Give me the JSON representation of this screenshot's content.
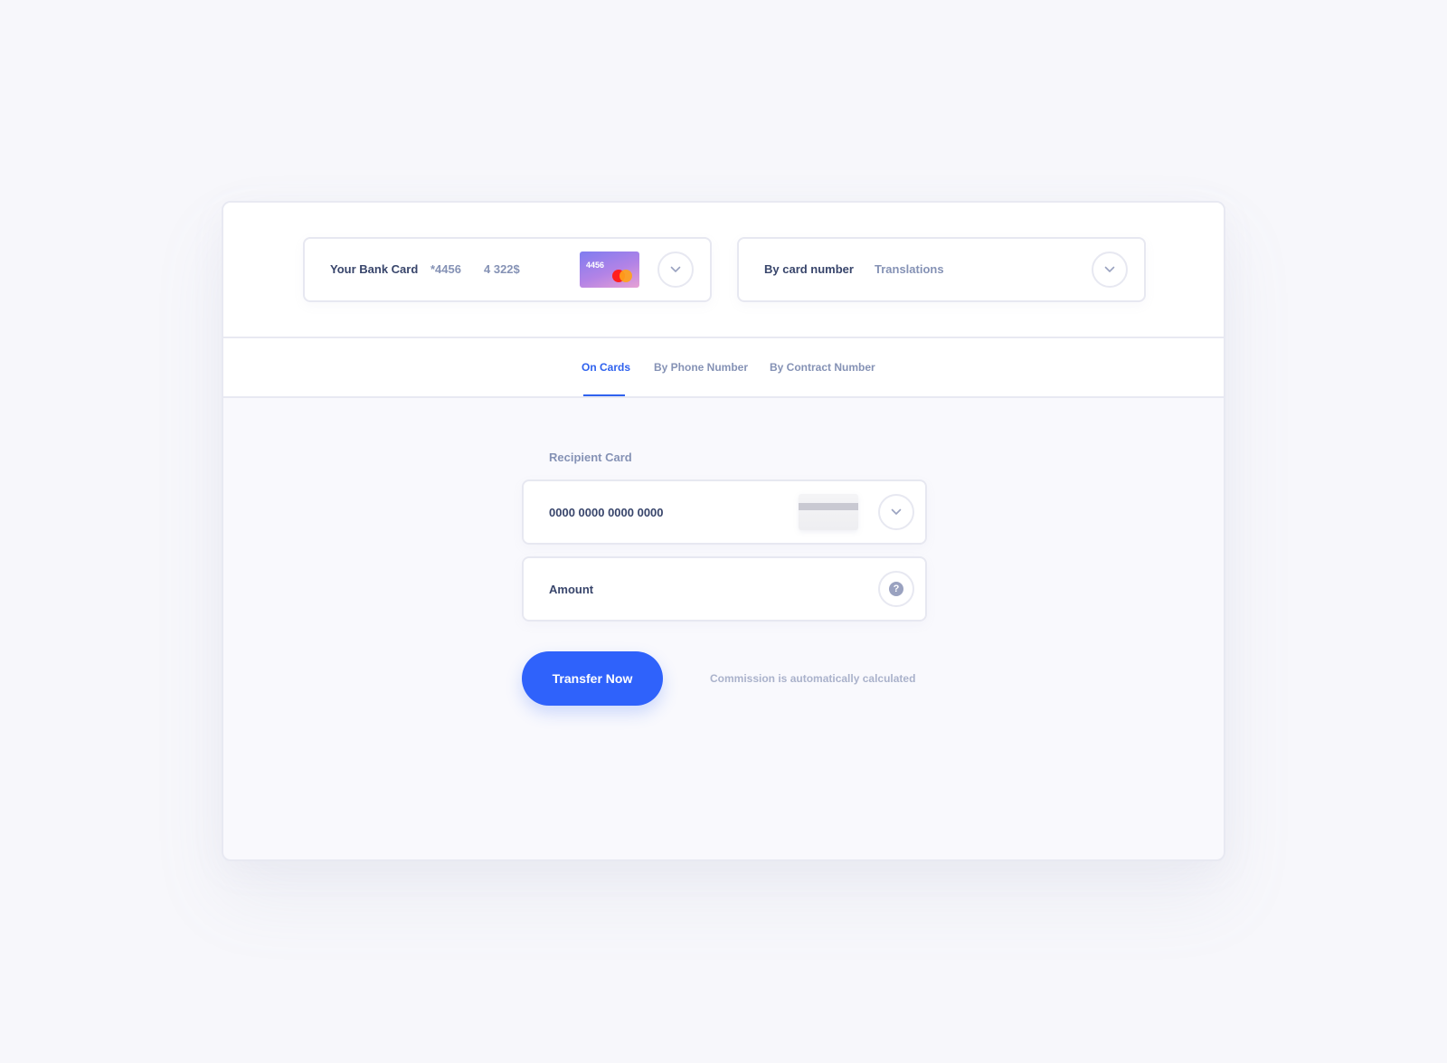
{
  "colors": {
    "accent": "#2f62fb",
    "text_dark": "#38456b",
    "text_muted": "#8592b5",
    "border": "#e7e8f1",
    "background": "#f7f7fb"
  },
  "source_card": {
    "label": "Your Bank Card",
    "masked_number": "*4456",
    "balance": "4 322$",
    "card_thumbnail_number": "4456",
    "card_brand_icon": "mastercard-logo-icon",
    "dropdown_icon": "chevron-down-icon"
  },
  "method_select": {
    "label": "By card number",
    "value": "Translations",
    "dropdown_icon": "chevron-down-icon"
  },
  "tabs": [
    {
      "label": "On Cards",
      "active": true
    },
    {
      "label": "By Phone Number",
      "active": false
    },
    {
      "label": "By Contract Number",
      "active": false
    }
  ],
  "form": {
    "recipient_label": "Recipient Card",
    "card_number_placeholder": "0000 0000 0000 0000",
    "amount_placeholder": "Amount",
    "help_icon_glyph": "?",
    "submit_label": "Transfer Now",
    "commission_note": "Commission is automatically calculated"
  }
}
